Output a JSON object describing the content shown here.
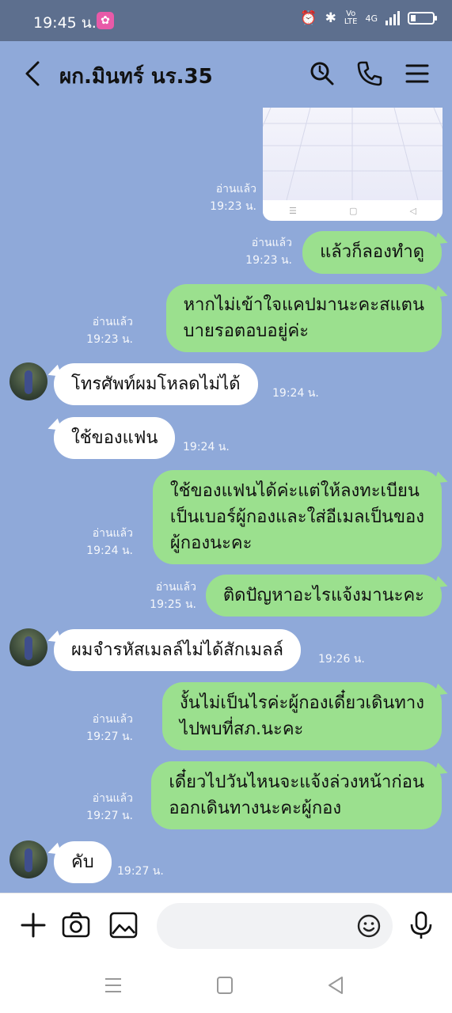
{
  "status_bar": {
    "time": "19:45 น.",
    "network": "4G",
    "lte_label": "Vo\nLTE"
  },
  "header": {
    "title": "ผก.มินทร์ นร.35"
  },
  "messages": [
    {
      "id": "m1",
      "side": "out",
      "type": "image",
      "read": "อ่านแล้ว",
      "time": "19:23 น."
    },
    {
      "id": "m2",
      "side": "out",
      "text": "แล้วก็ลองทำดู",
      "read": "อ่านแล้ว",
      "time": "19:23 น."
    },
    {
      "id": "m3",
      "side": "out",
      "text": "หากไม่เข้าใจแคปมานะคะสแตน\nบายรอตอบอยู่ค่ะ",
      "read": "อ่านแล้ว",
      "time": "19:23 น."
    },
    {
      "id": "m4",
      "side": "in",
      "text": "โทรศัพท์ผมโหลดไม่ได้",
      "time": "19:24 น."
    },
    {
      "id": "m5",
      "side": "in",
      "text": "ใช้ของแฟน",
      "time": "19:24 น."
    },
    {
      "id": "m6",
      "side": "out",
      "text": "ใช้ของแฟนได้ค่ะแต่ให้ลงทะเบียน\nเป็นเบอร์ผู้กองและใส่อีเมลเป็นของ\nผู้กองนะคะ",
      "read": "อ่านแล้ว",
      "time": "19:24 น."
    },
    {
      "id": "m7",
      "side": "out",
      "text": "ติดปัญหาอะไรแจ้งมานะคะ",
      "read": "อ่านแล้ว",
      "time": "19:25 น."
    },
    {
      "id": "m8",
      "side": "in",
      "text": "ผมจำรหัสเมลล์ไม่ได้สักเมลล์",
      "time": "19:26 น."
    },
    {
      "id": "m9",
      "side": "out",
      "text": "งั้นไม่เป็นไรค่ะผู้กองเดี๋ยวเดินทาง\nไปพบที่สภ.นะคะ",
      "read": "อ่านแล้ว",
      "time": "19:27 น."
    },
    {
      "id": "m10",
      "side": "out",
      "text": "เดี๋ยวไปวันไหนจะแจ้งล่วงหน้าก่อน\nออกเดินทางนะคะผู้กอง",
      "read": "อ่านแล้ว",
      "time": "19:27 น."
    },
    {
      "id": "m11",
      "side": "in",
      "text": "คับ",
      "time": "19:27 น."
    }
  ],
  "colors": {
    "chat_bg": "#8fa9d9",
    "out_bubble": "#9be08e",
    "in_bubble": "#ffffff",
    "status_bar": "#5d6f8e"
  },
  "icons": [
    "back-chevron-icon",
    "search-icon",
    "phone-icon",
    "menu-icon",
    "plus-icon",
    "camera-icon",
    "image-icon",
    "emoji-icon",
    "mic-icon",
    "nav-menu-icon",
    "nav-home-icon",
    "nav-back-icon"
  ]
}
